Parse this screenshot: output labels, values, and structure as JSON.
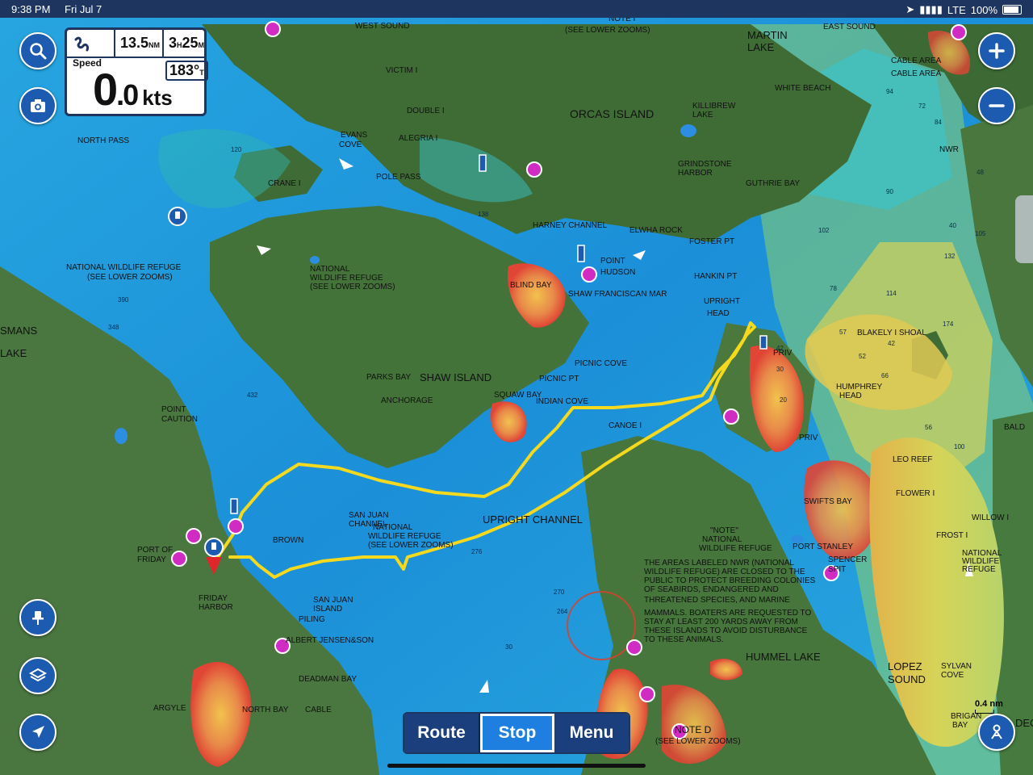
{
  "status_bar": {
    "time": "9:38 PM",
    "date": "Fri Jul 7",
    "network": "LTE",
    "battery": "100%"
  },
  "instrument": {
    "distance": "13.5",
    "distance_unit": "NM",
    "time_h": "3",
    "time_h_unit": "H",
    "time_m": "25",
    "time_m_unit": "M",
    "speed_label": "Speed",
    "speed_int": "0",
    "speed_dec": ".0",
    "speed_unit": "kts",
    "heading": "183°",
    "heading_unit": "T"
  },
  "bottom_bar": {
    "route": "Route",
    "stop": "Stop",
    "menu": "Menu"
  },
  "scale": "0.4 nm",
  "map_labels": [
    "WEST SOUND",
    "NOTE I",
    "(SEE LOWER ZOOMS)",
    "MARTIN",
    "LAKE",
    "EAST SOUND",
    "VICTIM I",
    "DOUBLE I",
    "ALEGRIA I",
    "EVANS",
    "COVE",
    "ORCAS ISLAND",
    "KILLIBREW",
    "LAKE",
    "WHITE BEACH",
    "CABLE AREA",
    "CABLE AREA",
    "NWR",
    "NORTH PASS",
    "POLE PASS",
    "CRANE I",
    "GRINDSTONE",
    "HARBOR",
    "GUTHRIE BAY",
    "HARNEY CHANNEL",
    "ELWHA ROCK",
    "FOSTER PT",
    "POINT",
    "HUDSON",
    "NATIONAL WILDLIFE REFUGE",
    "(SEE LOWER ZOOMS)",
    "NATIONAL",
    "WILDLIFE REFUGE",
    "(SEE LOWER ZOOMS)",
    "BLIND BAY",
    "SHAW FRANCISCAN MAR",
    "HANKIN PT",
    "UPRIGHT",
    "HEAD",
    "SMANS",
    "LAKE",
    "BLAKELY I SHOAL",
    "PRIV",
    "PARKS BAY",
    "SHAW ISLAND",
    "PICNIC PT",
    "PICNIC COVE",
    "ANCHORAGE",
    "SQUAW BAY",
    "INDIAN COVE",
    "HUMPHREY",
    "HEAD",
    "POINT",
    "CAUTION",
    "CANOE I",
    "PRIV",
    "LEO REEF",
    "SAN JUAN",
    "CHANNEL",
    "UPRIGHT CHANNEL",
    "SWIFTS BAY",
    "FLOWER I",
    "WILLOW I",
    "FROST I",
    "BROWN",
    "PORT OF",
    "FRIDAY",
    "NATIONAL",
    "WILDLIFE REFUGE",
    "(SEE LOWER ZOOMS)",
    "\"NOTE\"",
    "NATIONAL",
    "WILDLIFE REFUGE",
    "PORT STANLEY",
    "SPENCER",
    "SPIT",
    "NATIONAL",
    "WILDLIFE",
    "REFUGE",
    "FRIDAY",
    "HARBOR",
    "SAN JUAN",
    "ISLAND",
    "PILING",
    "ALBERT JENSEN&SON",
    "THE AREAS LABELED NWR (NATIONAL",
    "WILDLIFE REFUGE) ARE CLOSED TO THE",
    "PUBLIC TO PROTECT BREEDING COLONIES",
    "OF SEABIRDS, ENDANGERED AND",
    "THREATENED SPECIES, AND MARINE",
    "MAMMALS. BOATERS ARE REQUESTED TO",
    "STAY AT LEAST 200 YARDS AWAY FROM",
    "THESE ISLANDS TO AVOID DISTURBANCE",
    "TO THESE ANIMALS.",
    "HUMMEL LAKE",
    "LOPEZ",
    "SOUND",
    "SYLVAN",
    "COVE",
    "DEADMAN BAY",
    "ARGYLE",
    "NORTH BAY",
    "CABLE",
    "NOTE D",
    "(SEE LOWER ZOOMS)",
    "BRIGAN",
    "BAY",
    "BALD",
    "DEC"
  ],
  "depth_labels": [
    "138",
    "94",
    "90",
    "102",
    "78",
    "114",
    "132",
    "174",
    "105",
    "52",
    "66",
    "56",
    "100",
    "84",
    "72",
    "40",
    "48",
    "42",
    "20",
    "30",
    "276",
    "270",
    "264",
    "390",
    "348",
    "432",
    "120",
    "30",
    "57",
    "42"
  ],
  "colors": {
    "deep_water": "#1f8fd8",
    "mid_water": "#3cc3e0",
    "shallow_water": "#c9d35a",
    "very_shallow": "#e9a04a",
    "shoal": "#e24b3c",
    "land": "#3f6b35",
    "track": "#f4d91e",
    "ui_blue": "#1d5bb0",
    "ui_dark": "#1e355f"
  }
}
